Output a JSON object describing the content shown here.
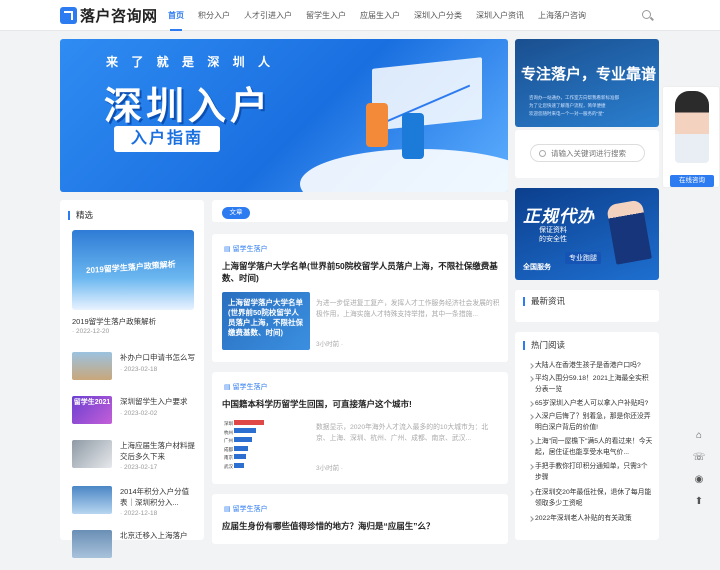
{
  "header": {
    "logo_text": "落户咨询网",
    "nav": [
      "首页",
      "积分入户",
      "人才引进入户",
      "留学生入户",
      "应届生入户",
      "深圳入户分类",
      "深圳入户资讯",
      "上海落户咨询"
    ]
  },
  "banner": {
    "subtitle": "来 了 就 是 深 圳 人",
    "title": "深圳入户",
    "tag": "入户指南"
  },
  "ad_top": {
    "title": "专注落户，专业靠谱",
    "lines": [
      "咨询办一站通办，工作室方向帮我看新标准都",
      "为了让您快速了解落户流程，简单便捷",
      "欢迎您随时来电一个一对一服务的“星”"
    ]
  },
  "search": {
    "placeholder": "请输入关键词进行搜索"
  },
  "service": {
    "button": "在线咨询"
  },
  "category": {
    "title": "精选",
    "featured": {
      "image_text": "2019留学生落户政策解析",
      "title": "2019留学生落户政策解析",
      "date": "2022-12-20"
    },
    "items": [
      {
        "title": "补办户口申请书怎么写",
        "date": "2023-02-18",
        "color": "#7fa9c9"
      },
      {
        "title": "深圳留学生入户要求",
        "date": "2023-02-02",
        "thumb_text": "留学生2021",
        "color": "#7b4fd1"
      },
      {
        "title": "上海应届生落户材料提交后多久下来",
        "date": "2023-02-17",
        "color": "#9aa7b3"
      },
      {
        "title": "2014年积分入户分值表｜深圳积分入...",
        "date": "2022-12-18",
        "color": "#5d93c2"
      },
      {
        "title": "北京迁移入上海落户",
        "date": "",
        "color": "#6a8fb5"
      }
    ]
  },
  "main": {
    "tab": "文章",
    "posts": [
      {
        "category": "留学生落户",
        "title": "上海留学落户大学名单(世界前50院校留学人员落户上海，不限社保缴费基数、时间)",
        "thumb_text": "上海留学落户大学名单(世界前50院校留学人员落户上海，不限社保缴费基数、时间)",
        "excerpt": "为进一步促进复工复产，发挥人才工作服务经济社会发展的积极作用，上海实施人才特殊支持举措，其中一条措施...",
        "time": "3小时前 ·"
      },
      {
        "category": "留学生落户",
        "title": "中国籍本科学历留学生回国，可直接落户这个城市!",
        "thumb_labels": [
          "深圳",
          "杭州",
          "广州",
          "成都",
          "南京",
          "武汉"
        ],
        "excerpt": "数据显示，2020年海外人才流入最多的的10大城市为：北京、上海、深圳、杭州、广州、成都、南京、武汉...",
        "time": "3小时前 ·"
      },
      {
        "category": "留学生落户",
        "title": "应届生身份有哪些值得珍惜的地方？海归是“应届生”么？"
      }
    ]
  },
  "ad_mid": {
    "title": "正规代办",
    "sub": [
      "保证资料",
      "的安全性"
    ],
    "badge1": "全国服务",
    "badge2": "专业跑腿"
  },
  "latest": {
    "title": "最新资讯"
  },
  "hot": {
    "title": "热门阅读",
    "items": [
      "大陆人在香港生孩子是香港户口吗?",
      "平均入围分59.18！2021上海最全实积分表一览",
      "65岁深圳入户老人可以拿入户补贴吗?",
      "入深户后悔了？别着急，那是你还没弄明白深户背后的价值!",
      "上海\"同一屋檐下\"满5人的看过来！今天起，居住证也能享受水电气价...",
      "手把手教你打印积分通知单，只需3个步骤",
      "在深圳交20年最低社保，退休了每月能领取多少工资呢",
      "2022年深圳老人补贴的有关政策"
    ]
  },
  "float_icons": [
    "home-icon",
    "phone-icon",
    "qq-icon",
    "arrow-up-icon"
  ]
}
